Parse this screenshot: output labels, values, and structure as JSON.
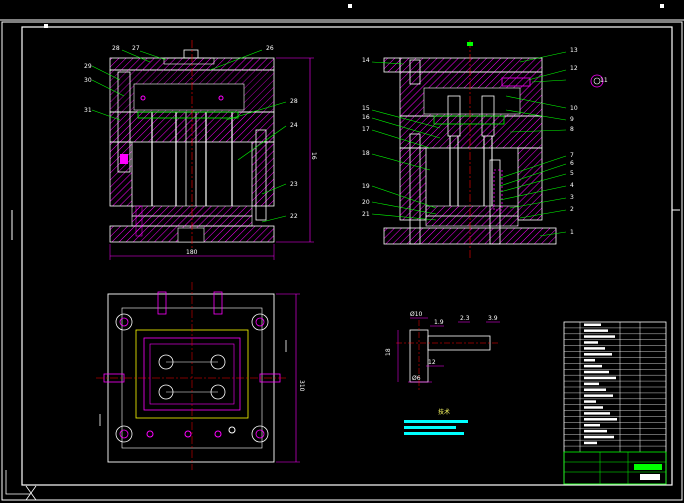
{
  "drawing": {
    "colors": {
      "background": "#000000",
      "outline": "#ffffff",
      "hatch": "#ff00ff",
      "leader": "#00ff00",
      "centerline": "#ff0000",
      "dimension": "#ff00ff",
      "parts": "#ffff00",
      "table": "#ffffff",
      "accent": "#00ffff"
    },
    "front_view": {
      "callouts": [
        "28",
        "27",
        "26",
        "29",
        "30",
        "31",
        "28",
        "24",
        "23",
        "22"
      ],
      "width_dim": "180",
      "height_dim": "16"
    },
    "side_view": {
      "callouts": [
        "14",
        "13",
        "12",
        "11",
        "10",
        "9",
        "8",
        "15",
        "16",
        "17",
        "18",
        "19",
        "20",
        "21",
        "7",
        "6",
        "5",
        "4",
        "3",
        "2",
        "1"
      ]
    },
    "plan_view": {
      "height_dim": "310"
    },
    "detail": {
      "dims": [
        "Ø10",
        "1.9",
        "2.3",
        "3.9",
        "18",
        "12",
        "Ø6"
      ]
    },
    "note_label": "技术",
    "title_block": {
      "rows": 22
    },
    "icons": [
      "ucs-axis-icon",
      "cad-cursor-icon"
    ]
  }
}
